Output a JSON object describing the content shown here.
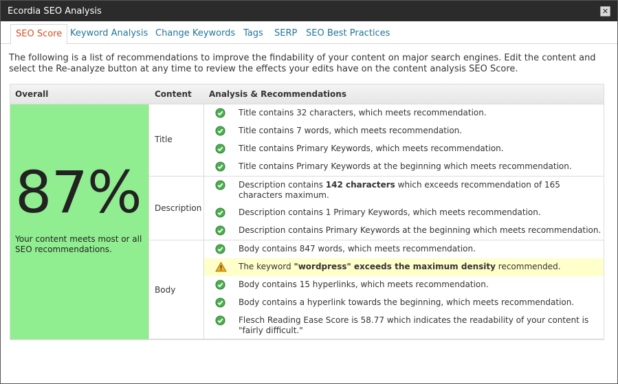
{
  "window": {
    "title": "Ecordia SEO Analysis",
    "close_label": "✕"
  },
  "tabs": [
    {
      "label": "SEO Score",
      "active": true
    },
    {
      "label": "Keyword Analysis",
      "active": false
    },
    {
      "label": "Change Keywords",
      "active": false
    },
    {
      "label": "Tags",
      "active": false
    },
    {
      "label": "SERP",
      "active": false
    },
    {
      "label": "SEO Best Practices",
      "active": false
    }
  ],
  "intro": "The following is a list of recommendations to improve the findability of your content on major search engines. Edit the content and select the Re-analyze button at any time to review the effects your edits have on the content analysis SEO Score.",
  "table": {
    "headers": {
      "overall": "Overall",
      "content": "Content",
      "analysis": "Analysis & Recommendations"
    },
    "score": "87%",
    "score_text": "Your content meets most or all SEO recommendations.",
    "score_color": "#90ee90",
    "groups": [
      {
        "label": "Title",
        "recs": [
          {
            "status": "ok",
            "parts": [
              {
                "t": "Title contains 32 characters, which meets recommendation."
              }
            ]
          },
          {
            "status": "ok",
            "parts": [
              {
                "t": "Title contains 7 words, which meets recommendation."
              }
            ]
          },
          {
            "status": "ok",
            "parts": [
              {
                "t": "Title contains Primary Keywords, which meets recommendation."
              }
            ]
          },
          {
            "status": "ok",
            "parts": [
              {
                "t": "Title contains Primary Keywords at the beginning which meets recommendation."
              }
            ]
          }
        ]
      },
      {
        "label": "Description",
        "recs": [
          {
            "status": "ok",
            "parts": [
              {
                "t": "Description contains "
              },
              {
                "t": "142 characters",
                "b": true
              },
              {
                "t": " which exceeds recommendation of 165 characters maximum."
              }
            ]
          },
          {
            "status": "ok",
            "parts": [
              {
                "t": "Description contains 1 Primary Keywords, which meets recommendation."
              }
            ]
          },
          {
            "status": "ok",
            "parts": [
              {
                "t": "Description contains Primary Keywords at the beginning which meets recommendation."
              }
            ]
          }
        ]
      },
      {
        "label": "Body",
        "recs": [
          {
            "status": "ok",
            "parts": [
              {
                "t": "Body contains 847 words, which meets recommendation."
              }
            ]
          },
          {
            "status": "warn",
            "parts": [
              {
                "t": "The keyword "
              },
              {
                "t": "\"wordpress\" exceeds the maximum density",
                "b": true
              },
              {
                "t": " recommended."
              }
            ]
          },
          {
            "status": "ok",
            "parts": [
              {
                "t": "Body contains 15 hyperlinks, which meets recommendation."
              }
            ]
          },
          {
            "status": "ok",
            "parts": [
              {
                "t": "Body contains a hyperlink towards the beginning, which meets recommendation."
              }
            ]
          },
          {
            "status": "ok",
            "parts": [
              {
                "t": "Flesch Reading Ease Score is 58.77 which indicates the readability of your content is \"fairly difficult.\""
              }
            ]
          }
        ]
      }
    ]
  },
  "colors": {
    "ok": "#4caf50",
    "warn": "#f0b020",
    "warn_bg": "#ffffcc",
    "link": "#21759b",
    "active_tab": "#d54e21"
  },
  "icons": {
    "ok": "check-circle-icon",
    "warn": "warning-triangle-icon"
  }
}
